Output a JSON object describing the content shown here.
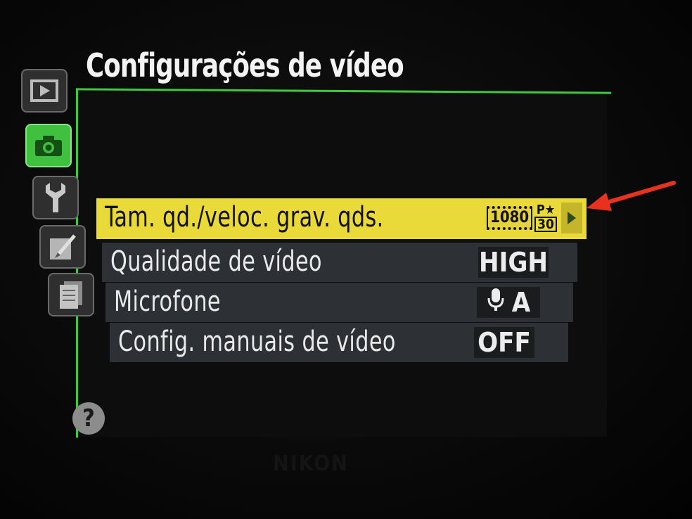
{
  "title": "Configurações de vídeo",
  "sidebar": {
    "tabs": [
      {
        "name": "playback",
        "icon": "playback-icon"
      },
      {
        "name": "shooting",
        "icon": "camera-icon",
        "active": true
      },
      {
        "name": "setup",
        "icon": "wrench-icon"
      },
      {
        "name": "retouch",
        "icon": "retouch-icon"
      },
      {
        "name": "my-menu",
        "icon": "my-menu-icon"
      }
    ],
    "help_label": "?"
  },
  "menu": {
    "items": [
      {
        "label": "Tam. qd./veloc. grav. qds.",
        "value_resolution": "1080",
        "value_quality_mark": "P★",
        "value_framerate": "30",
        "selected": true
      },
      {
        "label": "Qualidade de vídeo",
        "value": "HIGH"
      },
      {
        "label": "Microfone",
        "value": "A",
        "value_icon": "microphone-icon"
      },
      {
        "label": "Config. manuais de vídeo",
        "value": "OFF"
      }
    ]
  },
  "annotation": {
    "icon": "red-arrow-icon",
    "color": "#e8321e"
  },
  "colors": {
    "highlight": "#e9d939",
    "active_tab": "#3fc03f",
    "frame": "#3ec93e"
  },
  "brand": "NIKON"
}
